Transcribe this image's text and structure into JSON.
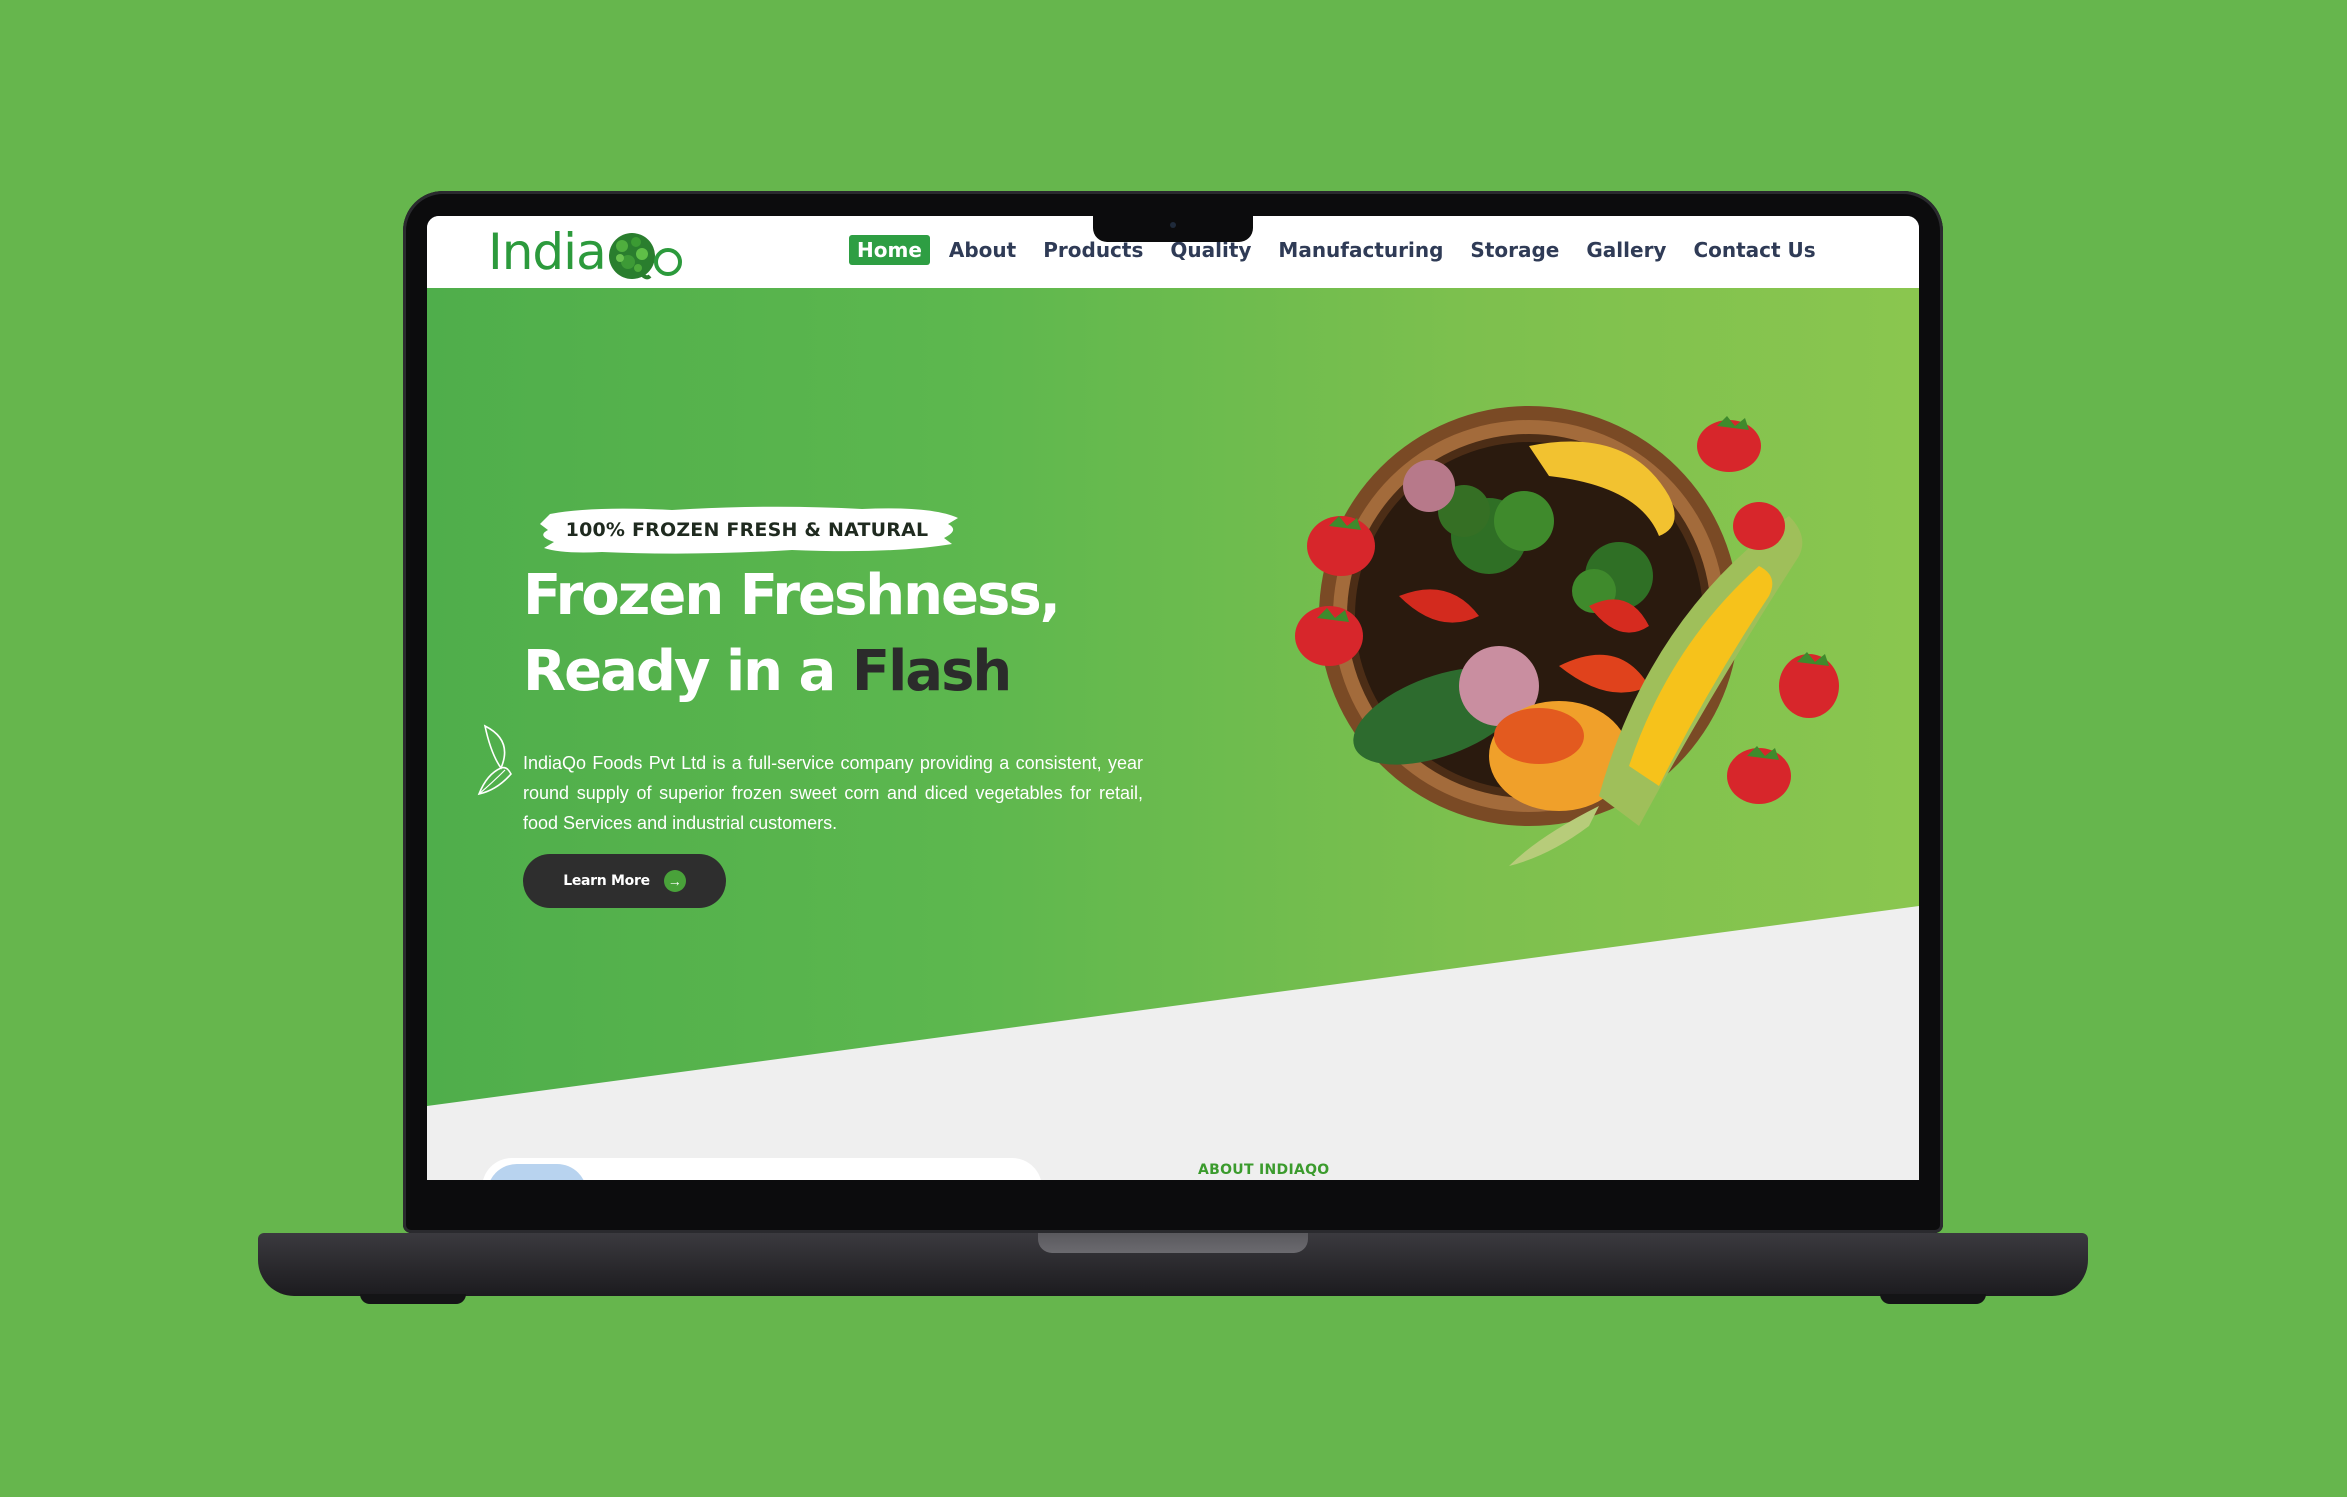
{
  "site": {
    "logo": {
      "text_before": "India",
      "text_after": "o"
    },
    "nav": [
      {
        "label": "Home",
        "active": true
      },
      {
        "label": "About",
        "active": false
      },
      {
        "label": "Products",
        "active": false
      },
      {
        "label": "Quality",
        "active": false
      },
      {
        "label": "Manufacturing",
        "active": false
      },
      {
        "label": "Storage",
        "active": false
      },
      {
        "label": "Gallery",
        "active": false
      },
      {
        "label": "Contact Us",
        "active": false
      }
    ]
  },
  "hero": {
    "badge": "100% FROZEN FRESH & NATURAL",
    "title_line1": "Frozen Freshness,",
    "title_line2_white": "Ready in a",
    "title_line2_dark": "Flash",
    "description": "IndiaQo Foods Pvt Ltd is a full-service company providing a consistent, year round supply of superior frozen sweet corn and diced vegetables for retail, food Services and industrial customers.",
    "button_label": "Learn More",
    "button_icon": "arrow-right-icon"
  },
  "about": {
    "label": "ABOUT INDIAQO"
  },
  "colors": {
    "background": "#66b64d",
    "brand_green": "#2e9e43",
    "nav_text": "#2f3b56",
    "dark_button": "#2e2e2e"
  }
}
